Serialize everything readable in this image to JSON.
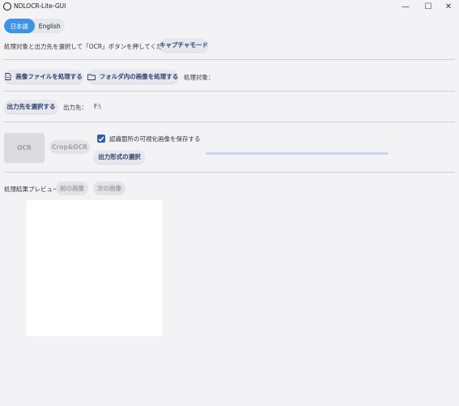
{
  "window": {
    "title": "NDLOCR-Lite-GUI",
    "minimize_glyph": "—",
    "maximize_glyph": "☐",
    "close_glyph": "✕"
  },
  "language": {
    "options": [
      "日本語",
      "English"
    ],
    "selected": "日本語"
  },
  "instructions": {
    "text": "処理対象と出力先を選択して「OCR」ボタンを押してください",
    "capture_mode_label": "キャプチャモード"
  },
  "input": {
    "process_image_label": "画像ファイルを処理する",
    "process_folder_label": "フォルダ内の画像を処理する",
    "target_label": "処理対象：",
    "target_value": ""
  },
  "output": {
    "select_label": "出力先を選択する",
    "dest_label": "出力先：",
    "dest_value": "F:\\"
  },
  "actions": {
    "ocr_label": "OCR",
    "crop_ocr_label": "Crop&OCR",
    "save_visualization_label": "認識箇所の可視化画像を保存する",
    "save_visualization_checked": true,
    "output_format_label": "出力形式の選択",
    "progress": 0
  },
  "preview": {
    "label": "処理結果プレビュー",
    "prev_label": "前の画像",
    "next_label": "次の画像"
  },
  "colors": {
    "accent": "#3d93e6",
    "checkbox": "#2f5fa8",
    "background": "#f3f3f6"
  }
}
